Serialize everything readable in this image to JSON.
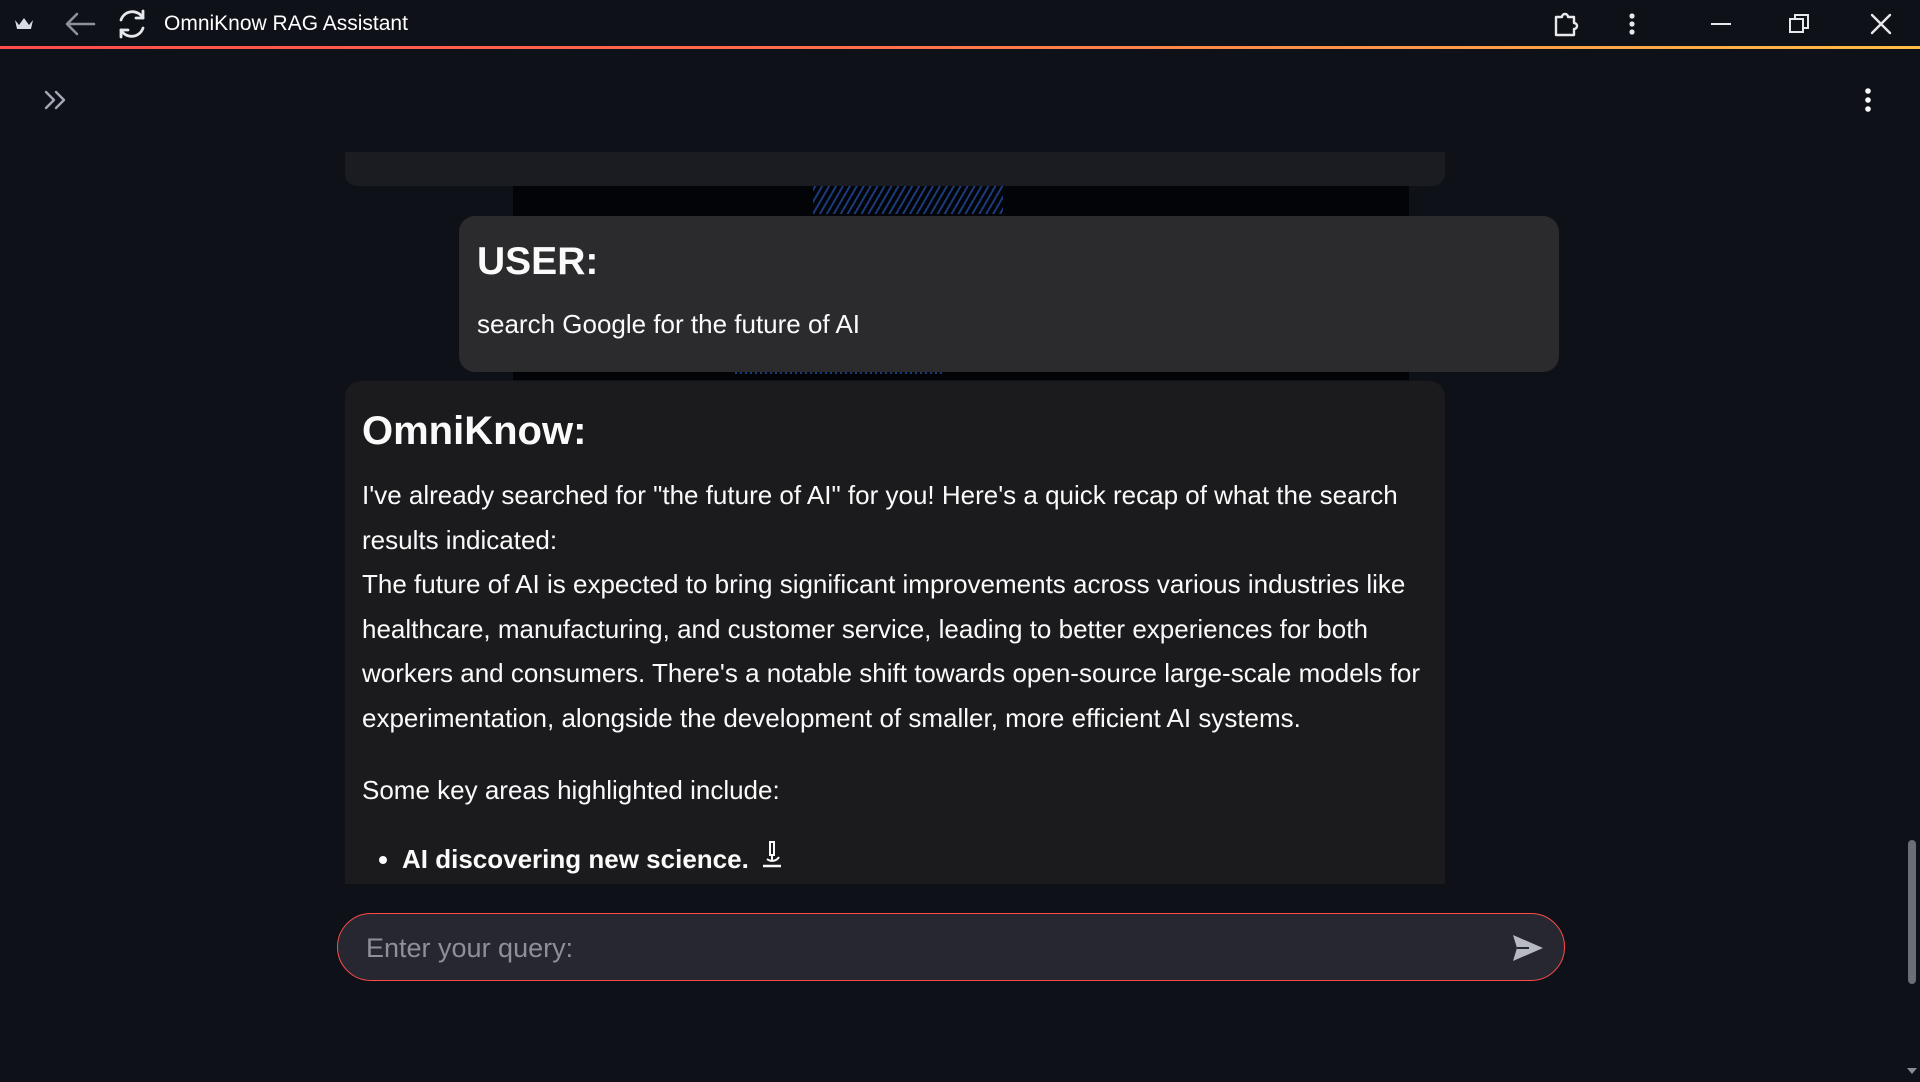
{
  "window": {
    "title": "OmniKnow RAG Assistant",
    "accent_colors": [
      "#ff4b4b",
      "#ffbd45"
    ],
    "icons": [
      "crown-icon",
      "back-arrow-icon",
      "reload-icon",
      "extension-icon",
      "kebab-menu-icon",
      "minimize-icon",
      "restore-icon",
      "close-icon"
    ]
  },
  "app": {
    "sidebar_toggle_icon": "double-chevron-right-icon",
    "menu_icon": "kebab-menu-icon"
  },
  "chat": {
    "user": {
      "role": "USER:",
      "text": "search Google for the future of AI"
    },
    "assistant": {
      "role": "OmniKnow:",
      "intro": "I've already searched for \"the future of AI\" for you! Here's a quick recap of what the search results indicated:",
      "summary": "The future of AI is expected to bring significant improvements across various industries like healthcare, manufacturing, and customer service, leading to better experiences for both workers and consumers. There's a notable shift towards open-source large-scale models for experimentation, alongside the development of smaller, more efficient AI systems.",
      "lead": "Some key areas highlighted include:",
      "bullets": [
        "AI discovering new science."
      ],
      "bullet_icon": "microscope-icon"
    }
  },
  "input": {
    "placeholder": "Enter your query:",
    "value": "",
    "border_color": "#ff4b4b",
    "send_icon": "send-icon"
  }
}
